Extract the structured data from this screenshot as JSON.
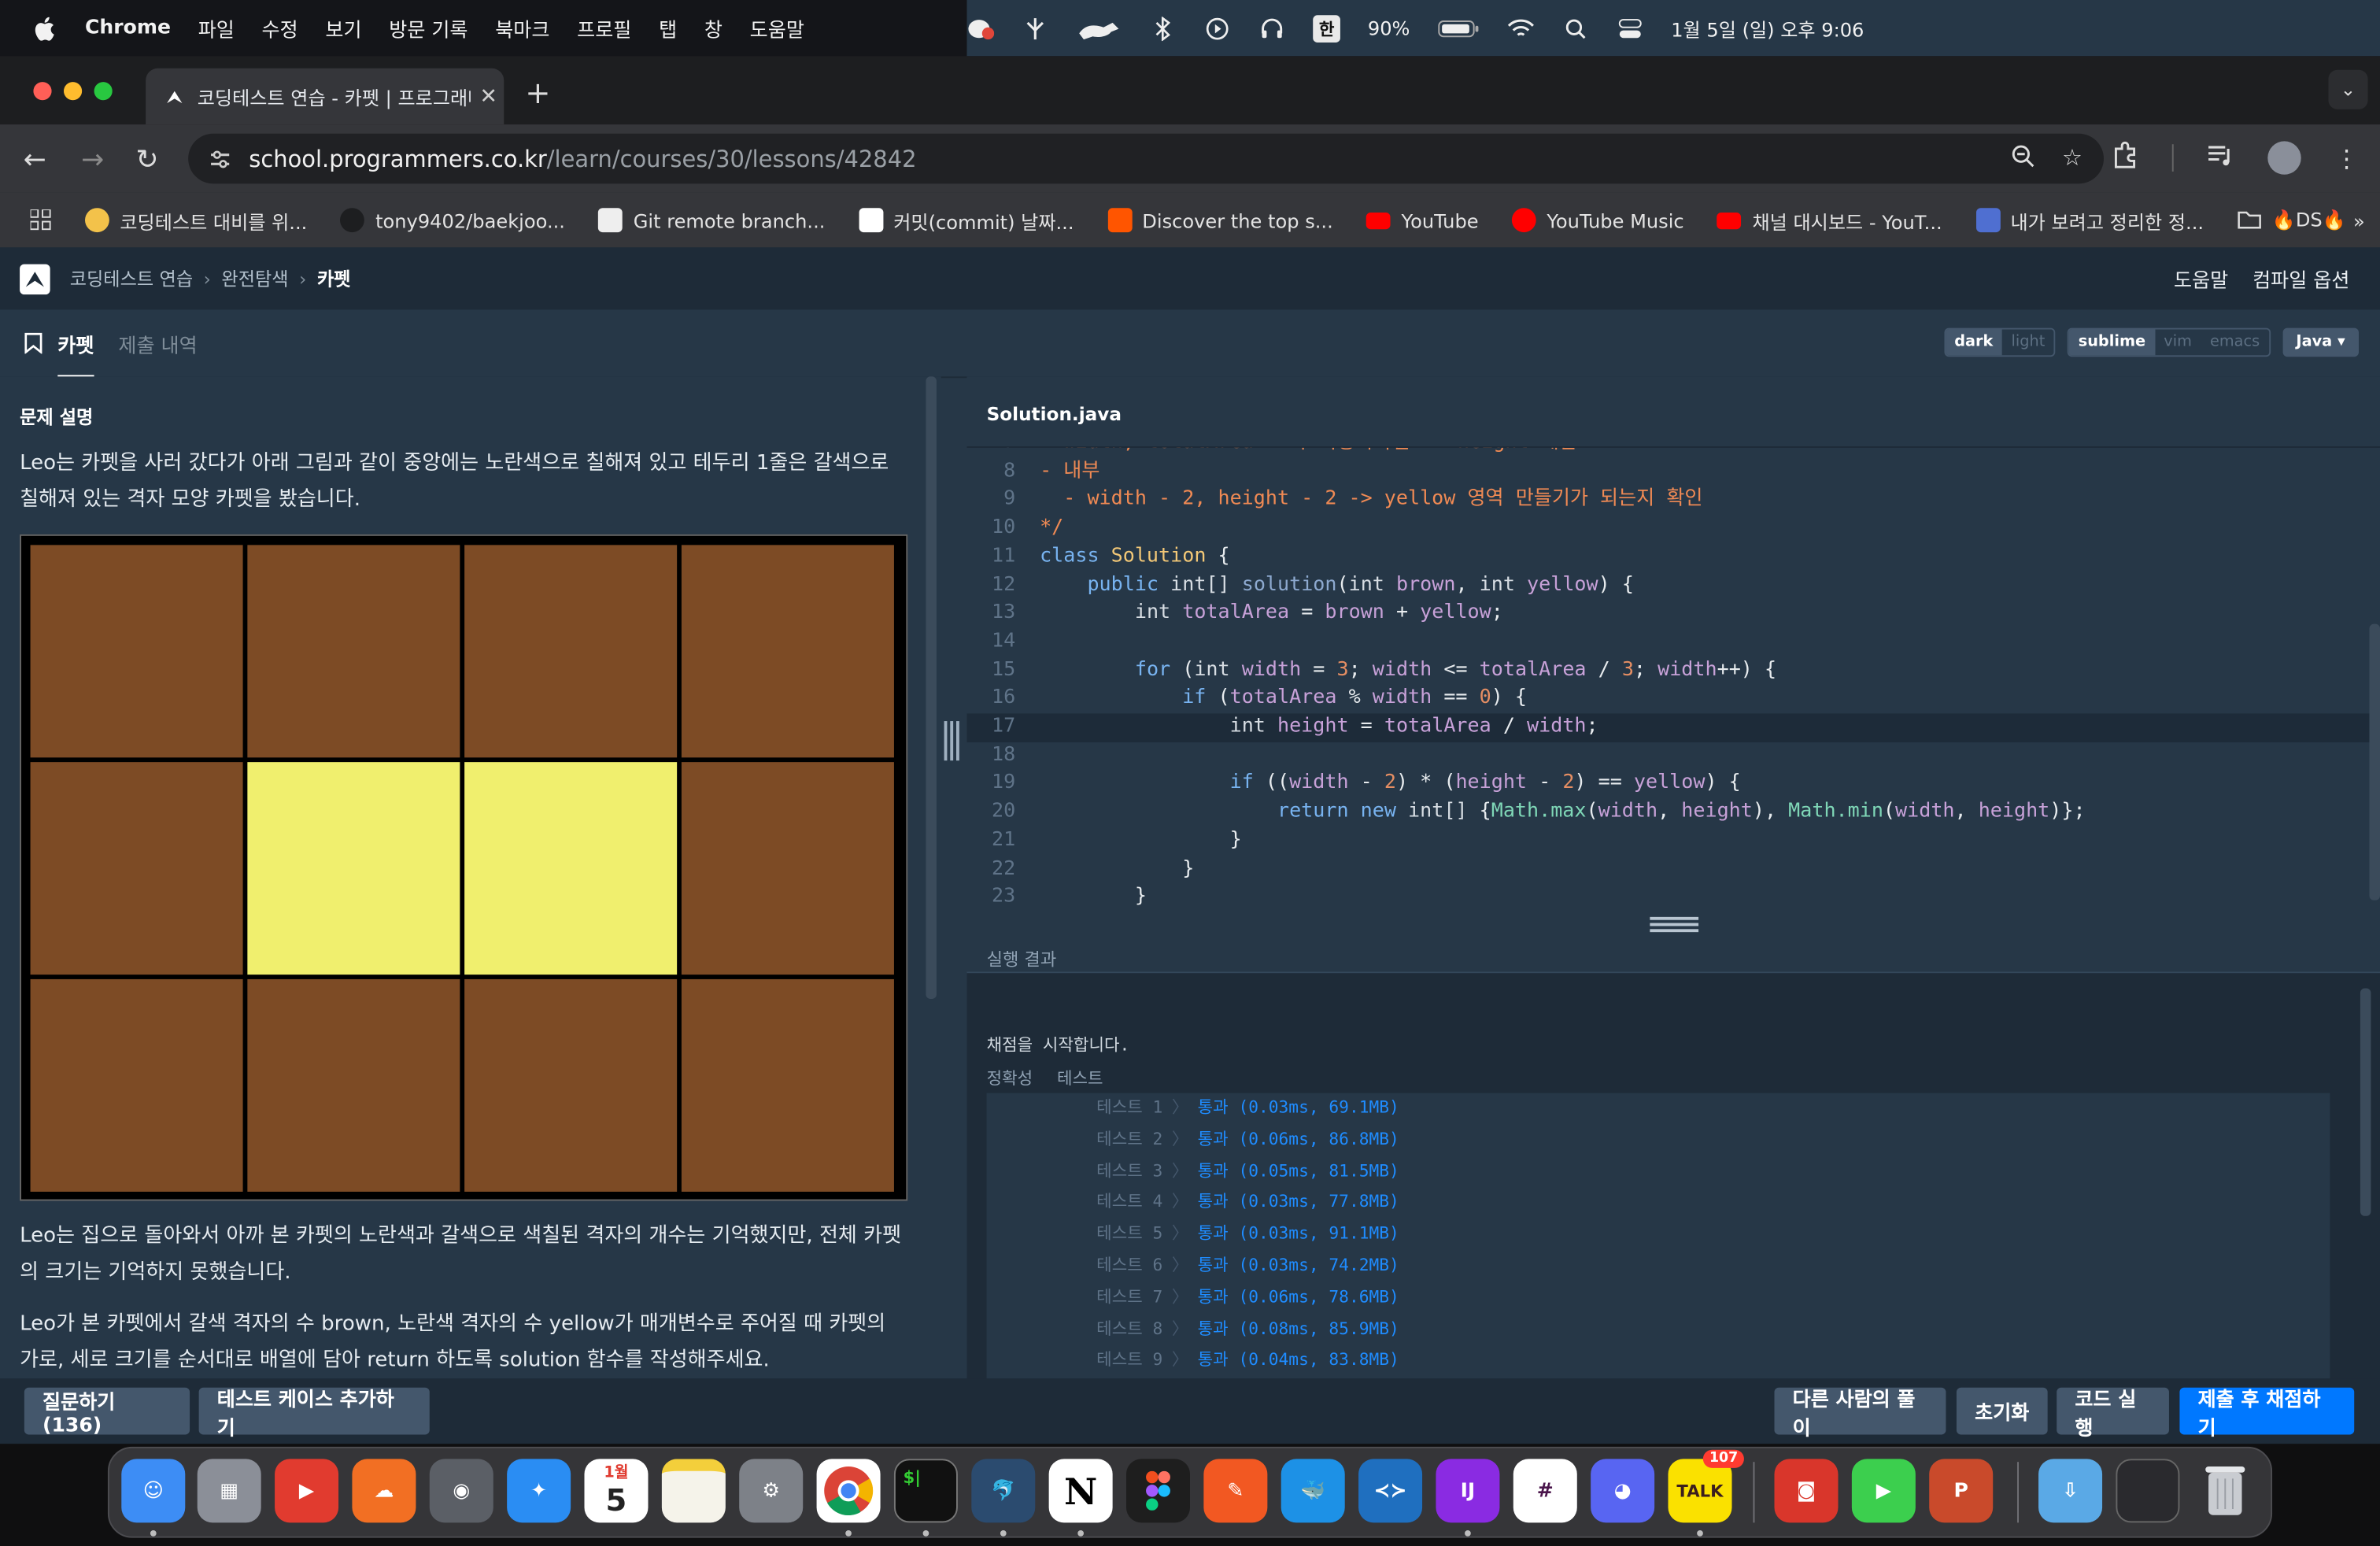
{
  "menubar": {
    "app": "Chrome",
    "items": [
      "파일",
      "수정",
      "보기",
      "방문 기록",
      "북마크",
      "프로필",
      "탭",
      "창",
      "도움말"
    ],
    "input_source": "한",
    "battery": "90%",
    "datetime": "1월 5일 (일) 오후 9:06"
  },
  "browser": {
    "tab_title": "코딩테스트 연습 - 카펫 | 프로그래머스",
    "url_host": "school.programmers.co.kr",
    "url_path": "/learn/courses/30/lessons/42842",
    "bookmarks": [
      {
        "label": "코딩테스트 대비를 위...",
        "color": "#f3c24a"
      },
      {
        "label": "tony9402/baekjoo...",
        "color": "#1d1e20"
      },
      {
        "label": "Git remote branch...",
        "color": "#eeeeee"
      },
      {
        "label": "커밋(commit) 날짜...",
        "color": "#ffffff"
      },
      {
        "label": "Discover the top s...",
        "color": "#ff5500"
      },
      {
        "label": "YouTube",
        "color": "#ff0000"
      },
      {
        "label": "YouTube Music",
        "color": "#ff0000"
      },
      {
        "label": "채널 대시보드 - YouT...",
        "color": "#ff0000"
      },
      {
        "label": "내가 보려고 정리한 정...",
        "color": "#4f6fd1"
      },
      {
        "label": "🔥DS🔥",
        "color": "#35363a"
      }
    ]
  },
  "page": {
    "breadcrumb": [
      "코딩테스트 연습",
      "완전탐색",
      "카펫"
    ],
    "nav_links": [
      "도움말",
      "컴파일 옵션"
    ],
    "tabs": [
      "카펫",
      "제출 내역"
    ],
    "theme_options": [
      "dark",
      "light"
    ],
    "keymap_options": [
      "sublime",
      "vim",
      "emacs"
    ],
    "language": "Java",
    "section_title": "문제 설명",
    "para1": "Leo는 카펫을 사러 갔다가 아래 그림과 같이 중앙에는 노란색으로 칠해져 있고 테두리 1줄은 갈색으로 칠해져 있는 격자 모양 카펫을 봤습니다.",
    "para2": "Leo는 집으로 돌아와서 아까 본 카펫의 노란색과 갈색으로 색칠된 격자의 개수는 기억했지만, 전체 카펫의 크기는 기억하지 못했습니다.",
    "para3": "Leo가 본 카펫에서 갈색 격자의 수 brown, 노란색 격자의 수 yellow가 매개변수로 주어질 때 카펫의 가로, 세로 크기를 순서대로 배열에 담아 return 하도록 solution 함수를 작성해주세요.",
    "carpet": {
      "cols": 4,
      "rows": 3,
      "cells": [
        "B",
        "B",
        "B",
        "B",
        "B",
        "Y",
        "Y",
        "B",
        "B",
        "B",
        "B",
        "B"
      ],
      "brown_color": "#7d4b25",
      "yellow_color": "#f0ef6e"
    },
    "file_name": "Solution.java",
    "run_label": "실행 결과",
    "output_line": "채점을 시작합니다.",
    "output_tabs": [
      "정확성",
      "테스트"
    ],
    "results": [
      {
        "name": "테스트 1",
        "result": "통과 (0.03ms, 69.1MB)"
      },
      {
        "name": "테스트 2",
        "result": "통과 (0.06ms, 86.8MB)"
      },
      {
        "name": "테스트 3",
        "result": "통과 (0.05ms, 81.5MB)"
      },
      {
        "name": "테스트 4",
        "result": "통과 (0.03ms, 77.8MB)"
      },
      {
        "name": "테스트 5",
        "result": "통과 (0.03ms, 91.1MB)"
      },
      {
        "name": "테스트 6",
        "result": "통과 (0.03ms, 74.2MB)"
      },
      {
        "name": "테스트 7",
        "result": "통과 (0.06ms, 78.6MB)"
      },
      {
        "name": "테스트 8",
        "result": "통과 (0.08ms, 85.9MB)"
      },
      {
        "name": "테스트 9",
        "result": "통과 (0.04ms, 83.8MB)"
      }
    ],
    "footer_left": [
      "질문하기 (136)",
      "테스트 케이스 추가하기"
    ],
    "footer_right": [
      "다른 사람의 풀이",
      "초기화",
      "코드 실행",
      "제출 후 채점하기"
    ]
  },
  "dock": {
    "calendar_month": "1월",
    "calendar_day": "5",
    "talk_badge": "107"
  }
}
